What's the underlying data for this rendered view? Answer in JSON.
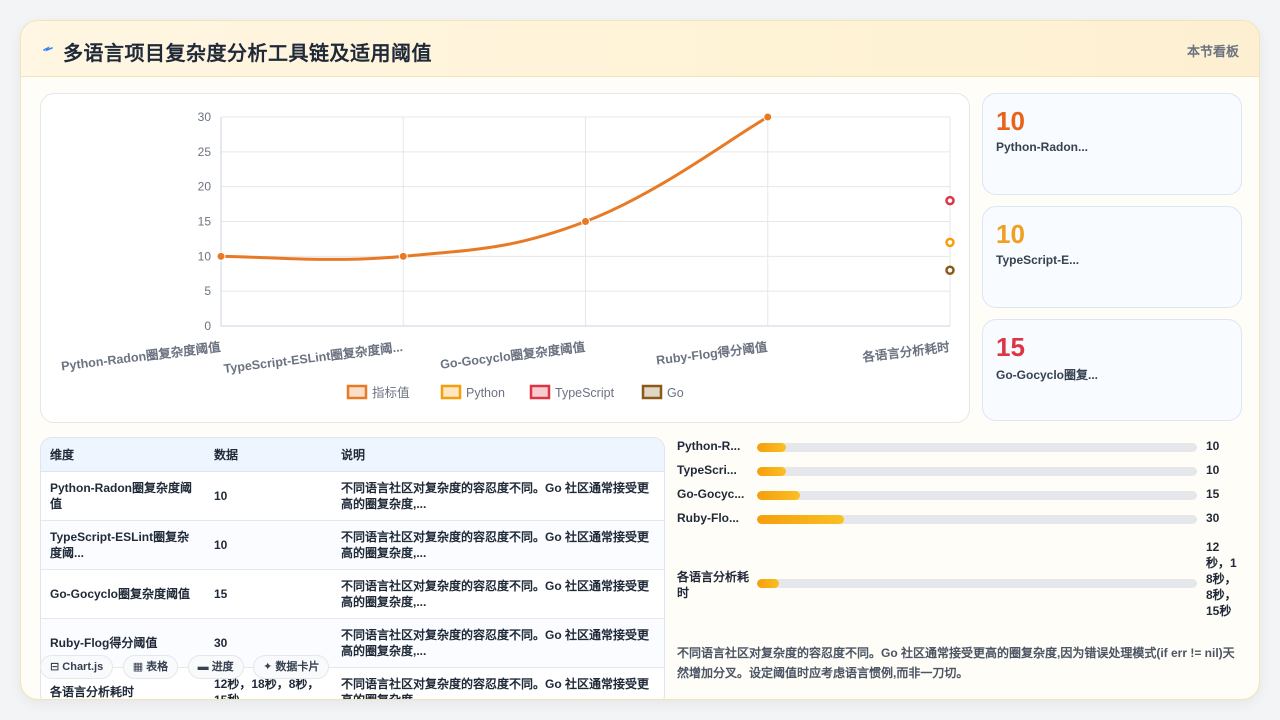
{
  "header": {
    "title": "多语言项目复杂度分析工具链及适用阈值",
    "badge": "本节看板"
  },
  "colors": {
    "orange": "#e87a25",
    "amber": "#f59e0b",
    "red": "#dc3545",
    "brown": "#8b5a1a"
  },
  "chart_data": {
    "type": "line",
    "categories": [
      "Python-Radon圈复杂度阈值",
      "TypeScript-ESLint圈复杂度阈...",
      "Go-Gocyclo圈复杂度阈值",
      "Ruby-Flog得分阈值",
      "各语言分析耗时"
    ],
    "series": [
      {
        "name": "指标值",
        "values": [
          10,
          10,
          15,
          30,
          null
        ]
      },
      {
        "name": "Python",
        "values": [
          null,
          null,
          null,
          null,
          12
        ]
      },
      {
        "name": "TypeScript",
        "values": [
          null,
          null,
          null,
          null,
          18
        ]
      },
      {
        "name": "Go",
        "values": [
          null,
          null,
          null,
          null,
          8
        ]
      }
    ],
    "yticks": [
      0,
      5,
      10,
      15,
      20,
      25,
      30
    ],
    "ylim": [
      0,
      30
    ],
    "grid": true,
    "legend": "bottom"
  },
  "kpis": [
    {
      "value": "10",
      "label": "Python-Radon...",
      "color": "#e8621a"
    },
    {
      "value": "10",
      "label": "TypeScript-E...",
      "color": "#f0a020"
    },
    {
      "value": "15",
      "label": "Go-Gocyclo圈复...",
      "color": "#dc3545"
    }
  ],
  "table": {
    "headers": [
      "维度",
      "数据",
      "说明"
    ],
    "rows": [
      [
        "Python-Radon圈复杂度阈值",
        "10",
        "不同语言社区对复杂度的容忍度不同。Go 社区通常接受更高的圈复杂度,..."
      ],
      [
        "TypeScript-ESLint圈复杂度阈...",
        "10",
        "不同语言社区对复杂度的容忍度不同。Go 社区通常接受更高的圈复杂度,..."
      ],
      [
        "Go-Gocyclo圈复杂度阈值",
        "15",
        "不同语言社区对复杂度的容忍度不同。Go 社区通常接受更高的圈复杂度,..."
      ],
      [
        "Ruby-Flog得分阈值",
        "30",
        "不同语言社区对复杂度的容忍度不同。Go 社区通常接受更高的圈复杂度,..."
      ],
      [
        "各语言分析耗时",
        "12秒，18秒，8秒，15秒",
        "不同语言社区对复杂度的容忍度不同。Go 社区通常接受更高的圈复杂度,..."
      ]
    ]
  },
  "progress": [
    {
      "label": "Python-R...",
      "value": "10",
      "fraction": 0.067
    },
    {
      "label": "TypeScri...",
      "value": "10",
      "fraction": 0.067
    },
    {
      "label": "Go-Gocyc...",
      "value": "15",
      "fraction": 0.097
    },
    {
      "label": "Ruby-Flo...",
      "value": "30",
      "fraction": 0.197
    },
    {
      "label": "各语言分析耗时",
      "value": "12秒，18秒，8秒，15秒",
      "fraction": 0.05
    }
  ],
  "note": "不同语言社区对复杂度的容忍度不同。Go 社区通常接受更高的圈复杂度,因为错误处理模式(if err != nil)天然增加分叉。设定阈值时应考虑语言惯例,而非一刀切。",
  "tabs": [
    {
      "label": "Chart.js",
      "icon": "⊟"
    },
    {
      "label": "表格",
      "icon": "▦"
    },
    {
      "label": "进度",
      "icon": "▬"
    },
    {
      "label": "数据卡片",
      "icon": "✦"
    }
  ]
}
